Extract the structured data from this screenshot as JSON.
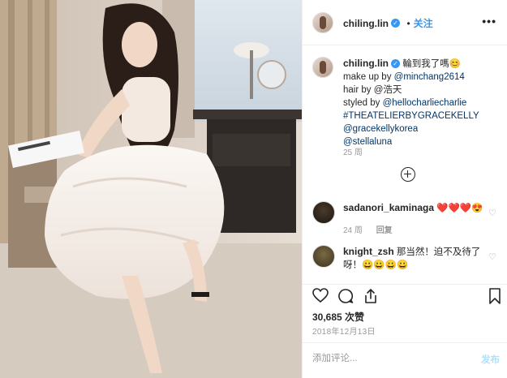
{
  "header": {
    "username": "chiling.lin",
    "follow_label": "关注",
    "more_label": "•••"
  },
  "caption": {
    "username": "chiling.lin",
    "lines": [
      "輪到我了嗎😊",
      "make up by ",
      "hair by @浩天",
      "styled by "
    ],
    "mention_minchang": "@minchang2614",
    "mention_hellocharlie": "@hellocharliecharlie",
    "hashtag": "#THEATELIERBYGRACEKELLY",
    "mention_gracekelly": "@gracekellykorea",
    "mention_stella": "@stellaluna",
    "time": "25 周"
  },
  "comments": [
    {
      "username": "sadanori_kaminaga",
      "text": "❤️❤️❤️😍",
      "time": "24 周",
      "reply_label": "回复"
    },
    {
      "username": "knight_zsh",
      "text": "那当然！迫不及待了呀！😀😀😀😀"
    }
  ],
  "likes": "30,685 次赞",
  "date": "2018年12月13日",
  "add_comment": {
    "placeholder": "添加评论...",
    "post_label": "发布"
  }
}
